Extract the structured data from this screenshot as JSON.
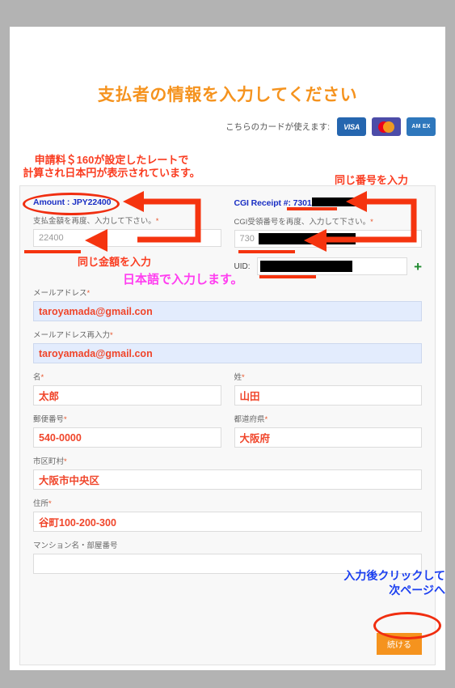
{
  "page": {
    "title": "支払者の情報を入力してください",
    "cards_label": "こちらのカードが使えます:",
    "cards": [
      {
        "name": "visa-card-logo",
        "label": "VISA"
      },
      {
        "name": "mastercard-logo",
        "label": ""
      },
      {
        "name": "amex-card-logo",
        "label": "AM EX"
      }
    ]
  },
  "form": {
    "amount_summary": "Amount : JPY22400",
    "amount_label": "支払金額を再度、入力して下さい。",
    "amount_value": "22400",
    "cgi_receipt_prefix": "CGI Receipt #: 7301",
    "cgi_label": "CGI受領番号を再度、入力して下さい。",
    "cgi_value_prefix": "730",
    "uid_label": "UID:",
    "uid_value": "",
    "add_uid_icon": "+",
    "email_label": "メールアドレス",
    "email_value": "taroyamada@gmail.con",
    "email_confirm_label": "メールアドレス再入力",
    "email_confirm_value": "taroyamada@gmail.con",
    "firstname_label": "名",
    "firstname_value": "太郎",
    "lastname_label": "姓",
    "lastname_value": "山田",
    "postal_label": "郵便番号",
    "postal_value": "540-0000",
    "prefecture_label": "都道府県",
    "prefecture_value": "大阪府",
    "city_label": "市区町村",
    "city_value": "大阪市中央区",
    "address_label": "住所",
    "address_value": "谷町100-200-300",
    "building_label": "マンション名・部屋番号",
    "building_value": "",
    "building_placeholder": "",
    "required_mark": "*",
    "submit_label": "続ける"
  },
  "annotations": {
    "rate_note": "申請料＄160が設定したレートで\n計算され日本円が表示されています。",
    "same_number": "同じ番号を入力",
    "same_amount": "同じ金額を入力",
    "japanese_input": "日本語で入力します。",
    "click_next": "入力後クリックして\n次ページへ"
  },
  "colors": {
    "title_orange": "#f5931e",
    "annotation_red": "#fa3c20",
    "annotation_blue": "#1a3ef0",
    "annotation_magenta": "#ff3df0",
    "field_text_red": "#f0452a",
    "summary_blue": "#1a2fc4",
    "button_orange": "#f5931e",
    "page_background": "#b3b3b3"
  }
}
